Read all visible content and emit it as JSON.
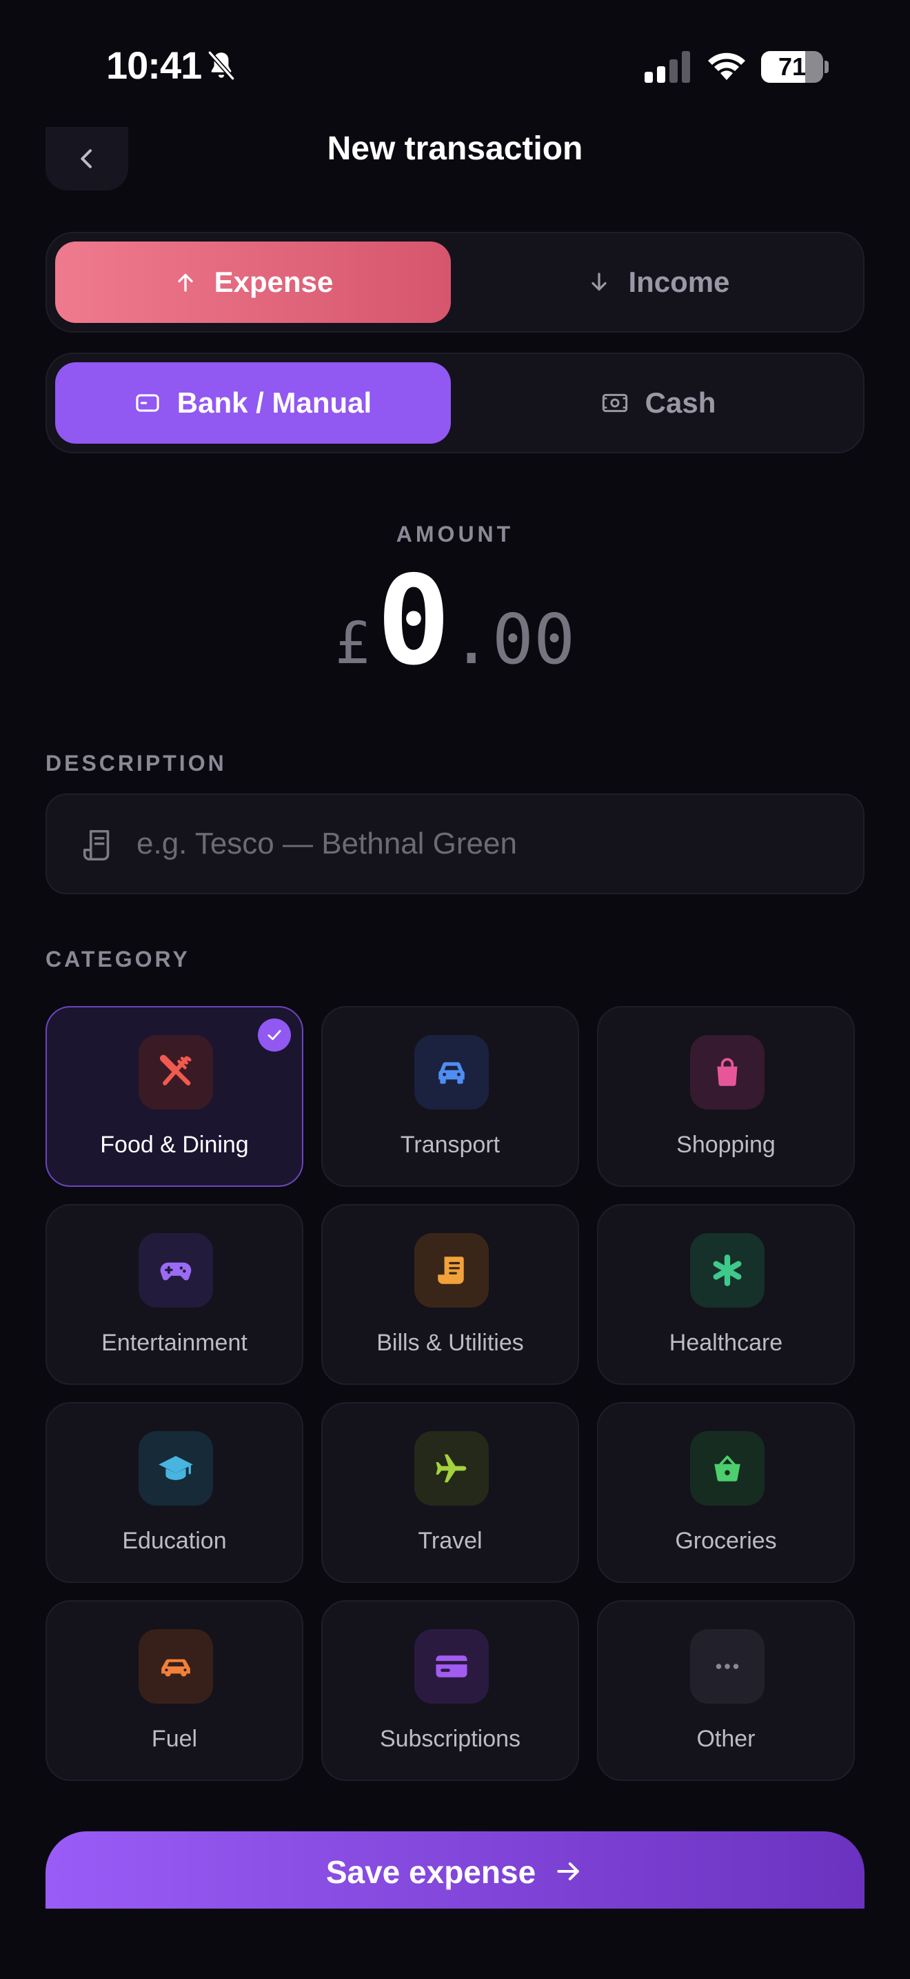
{
  "status_bar": {
    "time": "10:41",
    "battery_percent": "71",
    "battery_level": 0.71,
    "signal_bars_active": 2,
    "signal_bars_total": 4
  },
  "header": {
    "title": "New transaction",
    "back_icon": "chevron-left-icon"
  },
  "type_toggle": {
    "options": [
      {
        "label": "Expense",
        "icon": "arrow-up-icon",
        "selected": true
      },
      {
        "label": "Income",
        "icon": "arrow-down-icon",
        "selected": false
      }
    ]
  },
  "source_toggle": {
    "options": [
      {
        "label": "Bank / Manual",
        "icon": "card-icon",
        "selected": true
      },
      {
        "label": "Cash",
        "icon": "banknote-icon",
        "selected": false
      }
    ]
  },
  "amount": {
    "label": "AMOUNT",
    "currency": "£",
    "whole": "0",
    "fraction": ".00"
  },
  "description": {
    "label": "DESCRIPTION",
    "placeholder": "e.g. Tesco — Bethnal Green",
    "value": "",
    "icon": "receipt-icon"
  },
  "category": {
    "label": "CATEGORY",
    "items": [
      {
        "label": "Food & Dining",
        "icon": "utensils-icon",
        "color": "#f05a4f",
        "tile": "#3a1a25",
        "selected": true
      },
      {
        "label": "Transport",
        "icon": "car-icon",
        "color": "#4f8ef0",
        "tile": "#1b2240",
        "selected": false
      },
      {
        "label": "Shopping",
        "icon": "shopping-bag-icon",
        "color": "#e8569a",
        "tile": "#351a30",
        "selected": false
      },
      {
        "label": "Entertainment",
        "icon": "gamepad-icon",
        "color": "#9a6cf4",
        "tile": "#231b3c",
        "selected": false
      },
      {
        "label": "Bills & Utilities",
        "icon": "bill-icon",
        "color": "#f2a23a",
        "tile": "#3a2618",
        "selected": false
      },
      {
        "label": "Healthcare",
        "icon": "medical-icon",
        "color": "#3fc98a",
        "tile": "#16302a",
        "selected": false
      },
      {
        "label": "Education",
        "icon": "graduation-cap-icon",
        "color": "#48b4e0",
        "tile": "#162a38",
        "selected": false
      },
      {
        "label": "Travel",
        "icon": "plane-icon",
        "color": "#a4d23c",
        "tile": "#25291a",
        "selected": false
      },
      {
        "label": "Groceries",
        "icon": "basket-icon",
        "color": "#4ccf6c",
        "tile": "#172c21",
        "selected": false
      },
      {
        "label": "Fuel",
        "icon": "car-icon",
        "color": "#f2803a",
        "tile": "#37201a",
        "selected": false
      },
      {
        "label": "Subscriptions",
        "icon": "card-icon",
        "color": "#a25cf0",
        "tile": "#2a1a40",
        "selected": false
      },
      {
        "label": "Other",
        "icon": "ellipsis-icon",
        "color": "#8a8894",
        "tile": "#22202b",
        "selected": false
      }
    ]
  },
  "save_button": {
    "label": "Save expense",
    "icon": "arrow-right-icon"
  }
}
